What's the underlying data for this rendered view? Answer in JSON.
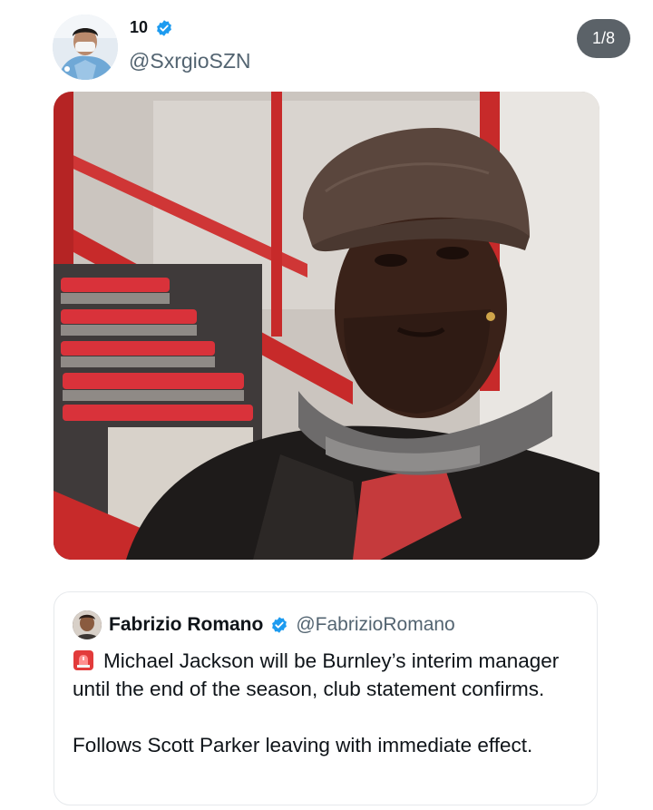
{
  "tweet": {
    "author_name": "10",
    "author_handle": "@SxrgioSZN",
    "image_counter": "1/8",
    "avatar_icon": "profile-photo-avatar",
    "verified_icon": "verified-badge-icon"
  },
  "media": {
    "photo_icon": "man-in-flat-cap-photo"
  },
  "quoted_tweet": {
    "author_name": "Fabrizio Romano",
    "author_handle": "@FabrizioRomano",
    "emoji_icon": "rotating-light-icon",
    "text_line1": "Michael Jackson will be Burnley’s interim manager until the end of the season, club statement confirms.",
    "text_line2": "Follows Scott Parker leaving with immediate effect."
  },
  "colors": {
    "verified_blue": "#1d9bf0",
    "counter_bg": "#5b6268",
    "handle_gray": "#536471",
    "stadium_red": "#c8282c"
  }
}
